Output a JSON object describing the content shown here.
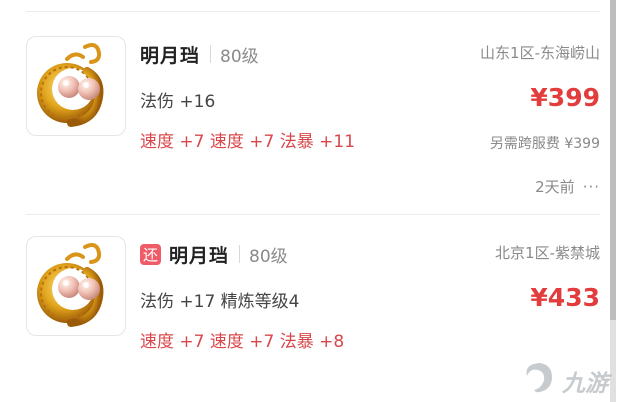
{
  "listings": [
    {
      "name": "明月珰",
      "level": "80级",
      "server": "山东1区-东海崂山",
      "stat": "法伤 +16",
      "price": "¥399",
      "bonus": "速度 +7 速度 +7 法暴 +11",
      "fee": "另需跨服费 ¥399",
      "time": "2天前",
      "more_icon": "···",
      "image_icon": "pearl-earring-icon"
    },
    {
      "badge": "还",
      "name": "明月珰",
      "level": "80级",
      "server": "北京1区-紫禁城",
      "stat": "法伤 +17 精炼等级4",
      "price": "¥433",
      "bonus": "速度 +7 速度 +7 法暴 +8",
      "image_icon": "pearl-earring-icon"
    }
  ],
  "watermark": {
    "text": "九游",
    "icon": "jiuyou-logo-icon"
  },
  "colors": {
    "price": "#e23c3c",
    "bonus": "#d9474a",
    "badge": "#ef5b66",
    "muted": "#8a8a8a"
  }
}
